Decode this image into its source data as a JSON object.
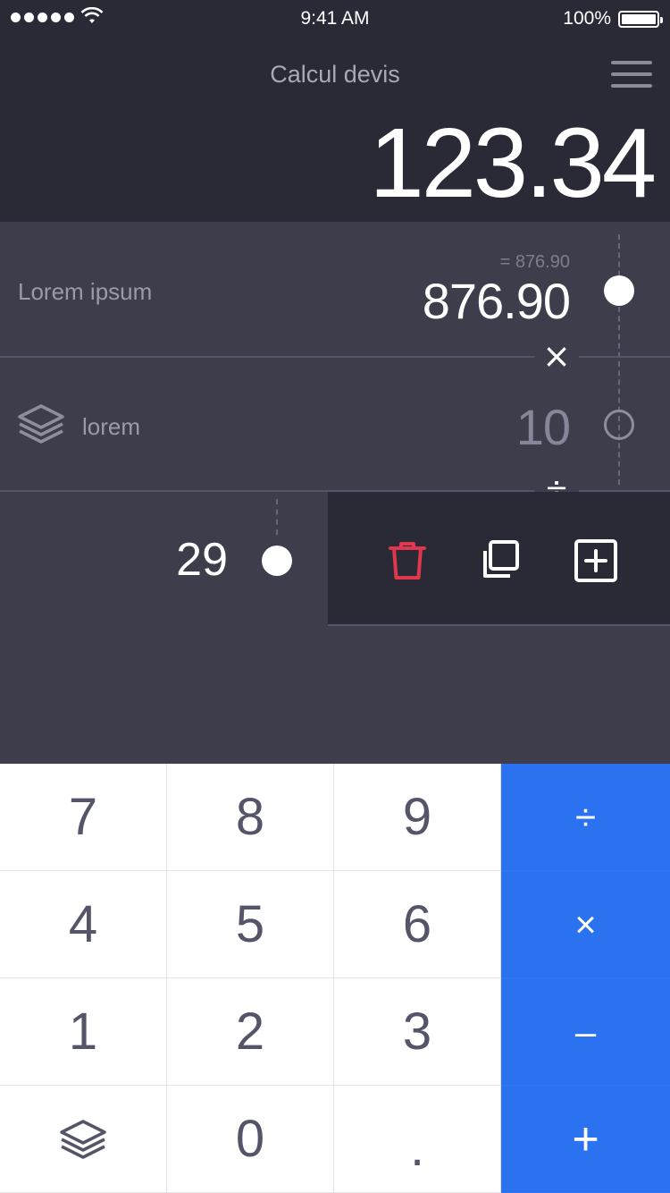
{
  "status": {
    "time": "9:41 AM",
    "battery": "100%"
  },
  "header": {
    "title": "Calcul devis",
    "total": "123.34"
  },
  "rows": [
    {
      "label": "Lorem ipsum",
      "sub_value": "= 876.90",
      "value": "876.90"
    },
    {
      "label": "lorem",
      "value": "10"
    },
    {
      "value": "29"
    }
  ],
  "operators_between_rows": [
    "×",
    "÷"
  ],
  "accent_color": "#2b72f0",
  "delete_color": "#e0374f",
  "keypad": {
    "keys": [
      "7",
      "8",
      "9",
      "÷",
      "4",
      "5",
      "6",
      "×",
      "1",
      "2",
      "3",
      "–",
      "",
      "0",
      ".",
      "+"
    ],
    "layers_key_icon": "layers-icon"
  }
}
